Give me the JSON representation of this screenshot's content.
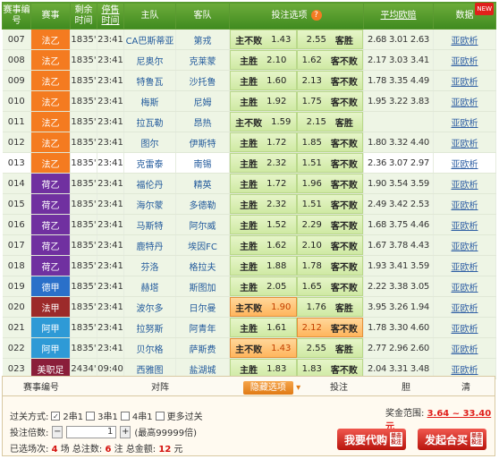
{
  "header": {
    "match_no": "赛事编号",
    "league": "赛事",
    "remaining": "剩余时间",
    "stop_sale": "停售时间",
    "home": "主队",
    "away": "客队",
    "bet_options": "投注选项",
    "avg_odds": "平均欧赔",
    "data": "数据",
    "help": "?",
    "new": "NEW"
  },
  "rows": [
    {
      "no": "007",
      "league": "法乙",
      "color": "#f47b20",
      "remain": "1835'",
      "stop": "23:41",
      "home": "CA巴斯蒂亚",
      "away": "第戎",
      "opt1_label": "主不败",
      "opt1_val": "1.43",
      "opt2_val": "2.55",
      "opt2_label": "客胜",
      "odds": "2.68 3.01 2.63",
      "links": "亚欧析",
      "sel1": false,
      "sel2": false
    },
    {
      "no": "008",
      "league": "法乙",
      "color": "#f47b20",
      "remain": "1835'",
      "stop": "23:41",
      "home": "尼奥尔",
      "away": "克莱蒙",
      "opt1_label": "主胜",
      "opt1_val": "2.10",
      "opt2_val": "1.62",
      "opt2_label": "客不败",
      "odds": "2.17 3.03 3.41",
      "links": "亚欧析",
      "sel1": false,
      "sel2": false
    },
    {
      "no": "009",
      "league": "法乙",
      "color": "#f47b20",
      "remain": "1835'",
      "stop": "23:41",
      "home": "特鲁瓦",
      "away": "沙托鲁",
      "opt1_label": "主胜",
      "opt1_val": "1.60",
      "opt2_val": "2.13",
      "opt2_label": "客不败",
      "odds": "1.78 3.35 4.49",
      "links": "亚欧析",
      "sel1": false,
      "sel2": false
    },
    {
      "no": "010",
      "league": "法乙",
      "color": "#f47b20",
      "remain": "1835'",
      "stop": "23:41",
      "home": "梅斯",
      "away": "尼姆",
      "opt1_label": "主胜",
      "opt1_val": "1.92",
      "opt2_val": "1.75",
      "opt2_label": "客不败",
      "odds": "1.95 3.22 3.83",
      "links": "亚欧析",
      "sel1": false,
      "sel2": false
    },
    {
      "no": "011",
      "league": "法乙",
      "color": "#f47b20",
      "remain": "1835'",
      "stop": "23:41",
      "home": "拉瓦勒",
      "away": "昂热",
      "opt1_label": "主不败",
      "opt1_val": "1.59",
      "opt2_val": "2.15",
      "opt2_label": "客胜",
      "odds": "",
      "links": "亚欧析",
      "sel1": false,
      "sel2": false
    },
    {
      "no": "012",
      "league": "法乙",
      "color": "#f47b20",
      "remain": "1835'",
      "stop": "23:41",
      "home": "图尔",
      "away": "伊斯特",
      "opt1_label": "主胜",
      "opt1_val": "1.72",
      "opt2_val": "1.85",
      "opt2_label": "客不败",
      "odds": "1.80 3.32 4.40",
      "links": "亚欧析",
      "sel1": false,
      "sel2": false
    },
    {
      "no": "013",
      "league": "法乙",
      "color": "#f47b20",
      "remain": "1835'",
      "stop": "23:41",
      "home": "克雷泰",
      "away": "南锡",
      "opt1_label": "主胜",
      "opt1_val": "2.32",
      "opt2_val": "1.51",
      "opt2_label": "客不败",
      "odds": "2.36 3.07 2.97",
      "links": "亚欧析",
      "sel1": false,
      "sel2": false,
      "white": true
    },
    {
      "no": "014",
      "league": "荷乙",
      "color": "#7030a0",
      "remain": "1835'",
      "stop": "23:41",
      "home": "福伦丹",
      "away": "精英",
      "opt1_label": "主胜",
      "opt1_val": "1.72",
      "opt2_val": "1.96",
      "opt2_label": "客不败",
      "odds": "1.90 3.54 3.59",
      "links": "亚欧析",
      "sel1": false,
      "sel2": false
    },
    {
      "no": "015",
      "league": "荷乙",
      "color": "#7030a0",
      "remain": "1835'",
      "stop": "23:41",
      "home": "海尔蒙",
      "away": "多德勒",
      "opt1_label": "主胜",
      "opt1_val": "2.32",
      "opt2_val": "1.51",
      "opt2_label": "客不败",
      "odds": "2.49 3.42 2.53",
      "links": "亚欧析",
      "sel1": false,
      "sel2": false
    },
    {
      "no": "016",
      "league": "荷乙",
      "color": "#7030a0",
      "remain": "1835'",
      "stop": "23:41",
      "home": "马斯特",
      "away": "阿尔威",
      "opt1_label": "主胜",
      "opt1_val": "1.52",
      "opt2_val": "2.29",
      "opt2_label": "客不败",
      "odds": "1.68 3.75 4.46",
      "links": "亚欧析",
      "sel1": false,
      "sel2": false
    },
    {
      "no": "017",
      "league": "荷乙",
      "color": "#7030a0",
      "remain": "1835'",
      "stop": "23:41",
      "home": "鹿特丹",
      "away": "埃因FC",
      "opt1_label": "主胜",
      "opt1_val": "1.62",
      "opt2_val": "2.10",
      "opt2_label": "客不败",
      "odds": "1.67 3.78 4.43",
      "links": "亚欧析",
      "sel1": false,
      "sel2": false
    },
    {
      "no": "018",
      "league": "荷乙",
      "color": "#7030a0",
      "remain": "1835'",
      "stop": "23:41",
      "home": "芬洛",
      "away": "格拉夫",
      "opt1_label": "主胜",
      "opt1_val": "1.88",
      "opt2_val": "1.78",
      "opt2_label": "客不败",
      "odds": "1.93 3.41 3.59",
      "links": "亚欧析",
      "sel1": false,
      "sel2": false
    },
    {
      "no": "019",
      "league": "德甲",
      "color": "#2a70c9",
      "remain": "1835'",
      "stop": "23:41",
      "home": "赫塔",
      "away": "斯图加",
      "opt1_label": "主胜",
      "opt1_val": "2.05",
      "opt2_val": "1.65",
      "opt2_label": "客不败",
      "odds": "2.22 3.38 3.05",
      "links": "亚欧析",
      "sel1": false,
      "sel2": false
    },
    {
      "no": "020",
      "league": "法甲",
      "color": "#9c2a2a",
      "remain": "1835'",
      "stop": "23:41",
      "home": "波尔多",
      "away": "日尔曼",
      "opt1_label": "主不败",
      "opt1_val": "1.90",
      "opt2_val": "1.76",
      "opt2_label": "客胜",
      "odds": "3.95 3.26 1.94",
      "links": "亚欧析",
      "sel1": true,
      "sel2": false
    },
    {
      "no": "021",
      "league": "阿甲",
      "color": "#2e9ad6",
      "remain": "1835'",
      "stop": "23:41",
      "home": "拉努斯",
      "away": "阿青年",
      "opt1_label": "主胜",
      "opt1_val": "1.61",
      "opt2_val": "2.12",
      "opt2_label": "客不败",
      "odds": "1.78 3.30 4.60",
      "links": "亚欧析",
      "sel1": false,
      "sel2": true
    },
    {
      "no": "022",
      "league": "阿甲",
      "color": "#2e9ad6",
      "remain": "1835'",
      "stop": "23:41",
      "home": "贝尔格",
      "away": "萨斯费",
      "opt1_label": "主不败",
      "opt1_val": "1.43",
      "opt2_val": "2.55",
      "opt2_label": "客胜",
      "odds": "2.77 2.96 2.60",
      "links": "亚欧析",
      "sel1": true,
      "sel2": false
    },
    {
      "no": "023",
      "league": "美职足",
      "color": "#8a1e3a",
      "remain": "2434'",
      "stop": "09:40",
      "home": "西雅图",
      "away": "盐湖城",
      "opt1_label": "主胜",
      "opt1_val": "1.83",
      "opt2_val": "1.83",
      "opt2_label": "客不败",
      "odds": "2.04 3.31 3.48",
      "links": "亚欧析",
      "sel1": false,
      "sel2": false
    }
  ],
  "bottom": {
    "col_no": "赛事编号",
    "col_vs": "对阵",
    "hide_opt": "隐藏选项",
    "col_bet": "投注",
    "col_dan": "胆",
    "col_clear": "清",
    "pass_label": "过关方式:",
    "pass_opts": [
      "2串1",
      "3串1",
      "4串1",
      "更多过关"
    ],
    "multi_label": "投注倍数:",
    "multi_value": "1",
    "multi_max": "(最高99999倍)",
    "selected_prefix": "已选场次:",
    "selected_count": "4",
    "selected_unit": "场",
    "total_bets_label": "总注数:",
    "total_bets": "6",
    "total_bets_unit": "注",
    "total_amount_label": "总金额:",
    "total_amount": "12",
    "total_amount_unit": "元",
    "prize_label": "奖金范围:",
    "prize_range": "3.64 ~ 33.40元",
    "btn_buy": "我要代购",
    "btn_buy_sub": "单击投注",
    "btn_join": "发起合买",
    "btn_join_sub": "单击投注"
  }
}
